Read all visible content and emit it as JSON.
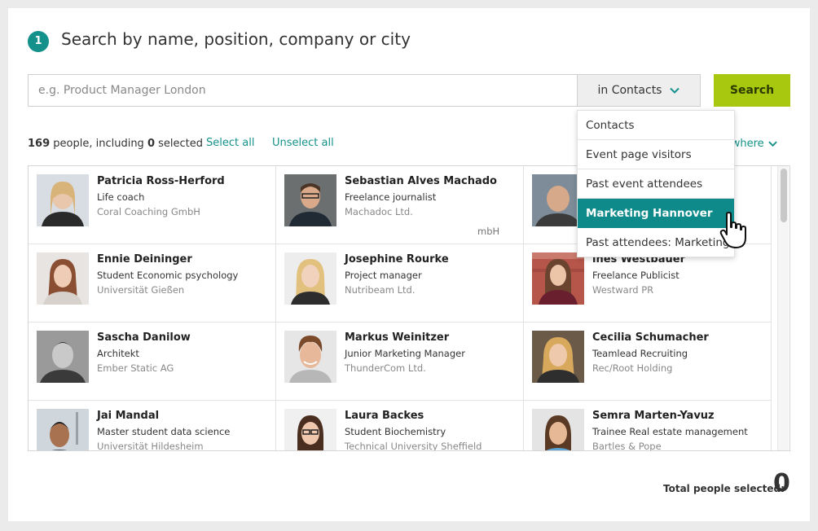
{
  "header": {
    "step_number": "1",
    "title": "Search by name, position, company or city"
  },
  "search": {
    "placeholder": "e.g. Product Manager London",
    "value": "",
    "scope_label": "in Contacts",
    "button_label": "Search"
  },
  "results_bar": {
    "count": "169",
    "count_text_1": " people, including ",
    "selected": "0",
    "count_text_2": " selected",
    "select_all": "Select all",
    "unselect_all": "Unselect all",
    "filter_label": "ywhere"
  },
  "dropdown": {
    "items": [
      {
        "label": "Contacts",
        "active": false
      },
      {
        "label": "Event page visitors",
        "active": false
      },
      {
        "label": "Past event attendees",
        "active": false
      },
      {
        "label": "Marketing Hannover",
        "active": true
      },
      {
        "label": "Past attendees: Marketing...",
        "active": false
      }
    ]
  },
  "people": [
    {
      "name": "Patricia Ross-Herford",
      "position": "Life coach",
      "company": "Coral Coaching GmbH"
    },
    {
      "name": "Sebastian Alves Machado",
      "position": "Freelance journalist",
      "company": "Machadoc Ltd."
    },
    {
      "name": "",
      "position": "",
      "company": ""
    },
    {
      "name": "Ennie Deininger",
      "position": "Student Economic psychology",
      "company": "Universität Gießen"
    },
    {
      "name": "Josephine Rourke",
      "position": "Project manager",
      "company": "Nutribeam Ltd."
    },
    {
      "name": "ines Westbauer",
      "position": "Freelance Publicist",
      "company": "Westward PR"
    },
    {
      "name": "Sascha Danilow",
      "position": "Architekt",
      "company": "Ember Static AG"
    },
    {
      "name": "Markus Weinitzer",
      "position": "Junior Marketing Manager",
      "company": "ThunderCom Ltd."
    },
    {
      "name": "Cecilia Schumacher",
      "position": "Teamlead Recruiting",
      "company": "Rec/Root Holding"
    },
    {
      "name": "Jai Mandal",
      "position": "Master student data science",
      "company": "Universität Hildesheim"
    },
    {
      "name": "Laura Backes",
      "position": "Student Biochemistry",
      "company": "Technical University Sheffield"
    },
    {
      "name": "Semra Marten-Yavuz",
      "position": "Trainee Real estate management",
      "company": "Bartles & Pope"
    }
  ],
  "truncated_company_suffix": "mbH",
  "footer": {
    "total_label": "Total people selected:",
    "total_value": "0"
  },
  "colors": {
    "accent_teal": "#13918a",
    "search_button": "#a7c80f",
    "dropdown_active": "#0f8a8a"
  },
  "icons": [
    "chevron-down-icon",
    "hand-pointer-cursor-icon"
  ]
}
